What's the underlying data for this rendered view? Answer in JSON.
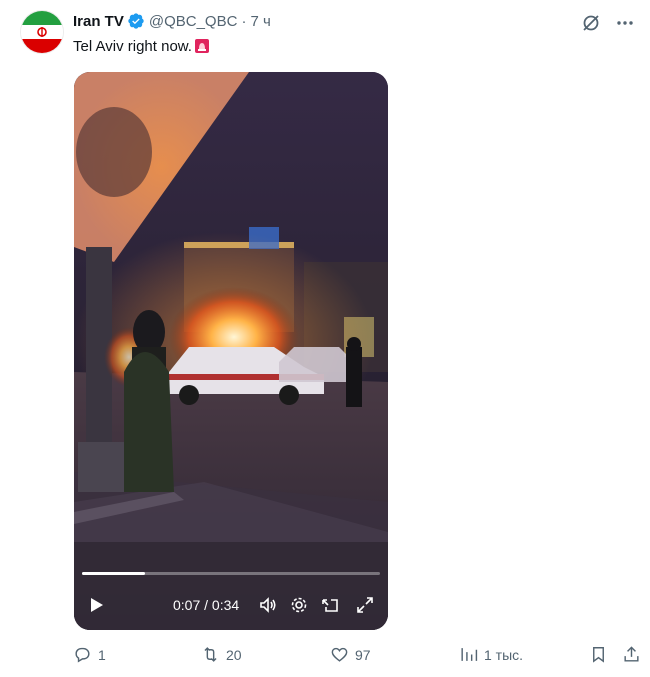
{
  "tweet": {
    "author_name": "Iran TV",
    "handle": "@QBC_QBC",
    "separator": "·",
    "time": "7 ч",
    "text": "Tel Aviv right now.",
    "emoji": "siren-emoji"
  },
  "video": {
    "current_time": "0:07",
    "duration": "0:34",
    "time_display": "0:07 / 0:34",
    "progress_fraction": 0.21
  },
  "actions": {
    "replies": "1",
    "reposts": "20",
    "likes": "97",
    "views": "1 тыс."
  },
  "colors": {
    "text": "#0f1419",
    "muted": "#536471",
    "verified": "#1d9bf0"
  }
}
